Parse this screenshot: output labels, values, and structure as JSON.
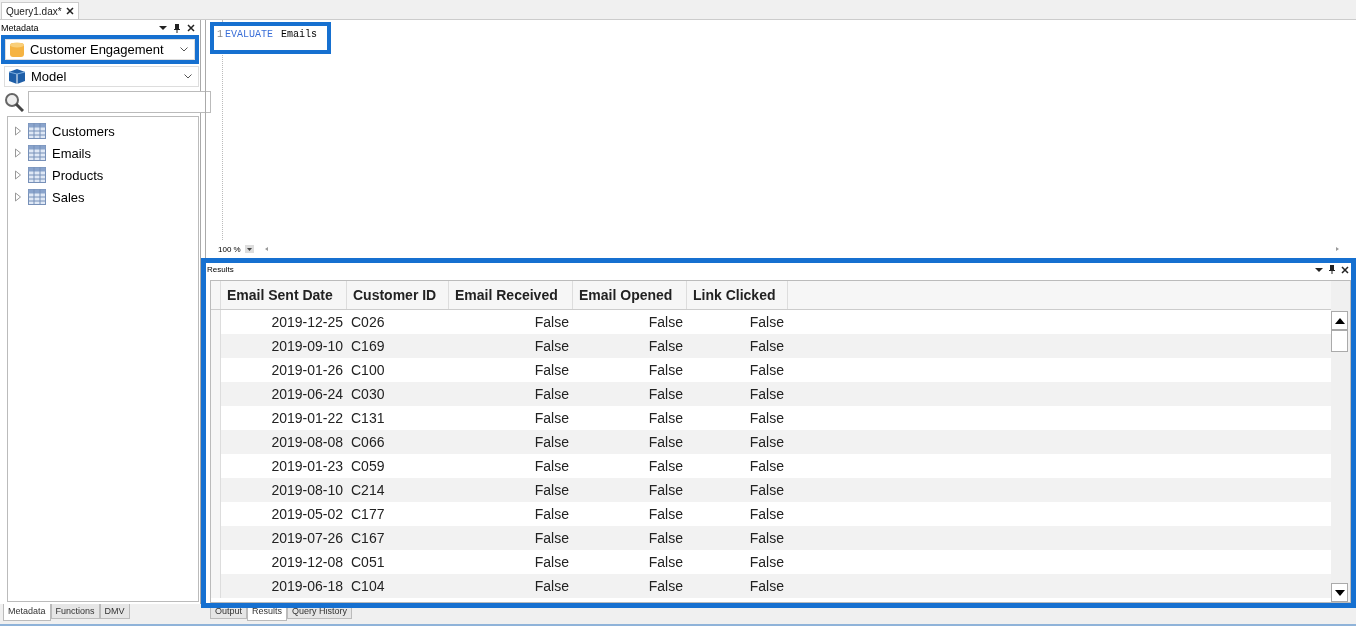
{
  "document_tabs": [
    {
      "label": "Query1.dax*",
      "selected": true
    }
  ],
  "metadata_panel": {
    "title": "Metadata",
    "database": {
      "label": "Customer Engagement",
      "highlighted": true
    },
    "model": {
      "label": "Model"
    },
    "tables": [
      {
        "label": "Customers",
        "expanded": false
      },
      {
        "label": "Emails",
        "expanded": false
      },
      {
        "label": "Products",
        "expanded": false
      },
      {
        "label": "Sales",
        "expanded": false
      }
    ]
  },
  "editor": {
    "line_number": "1",
    "keyword": "EVALUATE",
    "code": "Emails",
    "highlighted": true,
    "zoom": "100 %"
  },
  "results": {
    "title": "Results",
    "highlighted": true,
    "columns": [
      {
        "label": "Email Sent Date",
        "kind": "date"
      },
      {
        "label": "Customer ID",
        "kind": "id"
      },
      {
        "label": "Email Received",
        "kind": "boolean"
      },
      {
        "label": "Email Opened",
        "kind": "boolean"
      },
      {
        "label": "Link Clicked",
        "kind": "boolean"
      }
    ],
    "rows": [
      [
        "2019-12-25",
        "C026",
        "False",
        "False",
        "False"
      ],
      [
        "2019-09-10",
        "C169",
        "False",
        "False",
        "False"
      ],
      [
        "2019-01-26",
        "C100",
        "False",
        "False",
        "False"
      ],
      [
        "2019-06-24",
        "C030",
        "False",
        "False",
        "False"
      ],
      [
        "2019-01-22",
        "C131",
        "False",
        "False",
        "False"
      ],
      [
        "2019-08-08",
        "C066",
        "False",
        "False",
        "False"
      ],
      [
        "2019-01-23",
        "C059",
        "False",
        "False",
        "False"
      ],
      [
        "2019-08-10",
        "C214",
        "False",
        "False",
        "False"
      ],
      [
        "2019-05-02",
        "C177",
        "False",
        "False",
        "False"
      ],
      [
        "2019-07-26",
        "C167",
        "False",
        "False",
        "False"
      ],
      [
        "2019-12-08",
        "C051",
        "False",
        "False",
        "False"
      ],
      [
        "2019-06-18",
        "C104",
        "False",
        "False",
        "False"
      ]
    ]
  },
  "metadata_tabs": [
    {
      "label": "Metadata",
      "selected": true
    },
    {
      "label": "Functions",
      "selected": false
    },
    {
      "label": "DMV",
      "selected": false
    }
  ],
  "results_tabs": [
    {
      "label": "Output",
      "selected": false
    },
    {
      "label": "Results",
      "selected": true
    },
    {
      "label": "Query History",
      "selected": false
    }
  ]
}
